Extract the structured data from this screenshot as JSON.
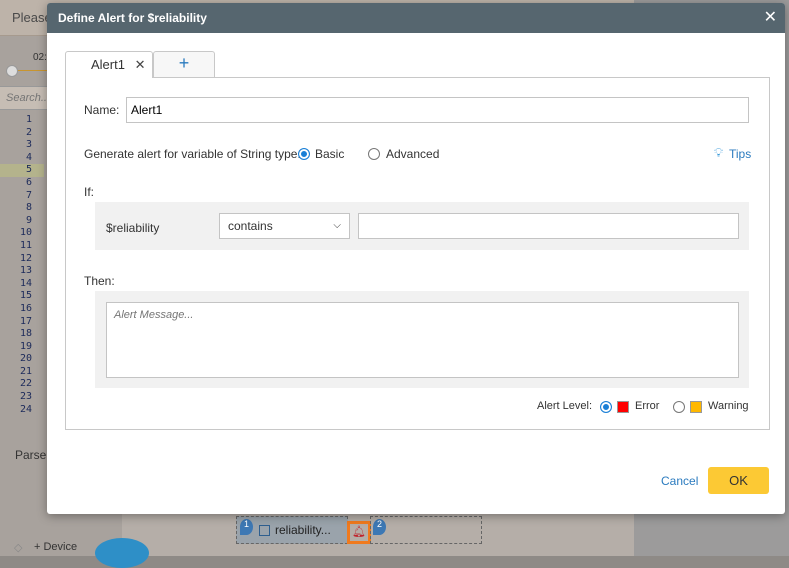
{
  "background": {
    "header_text": "Please",
    "time_label": "02:",
    "search_placeholder": "Search...",
    "line_numbers": [
      "1",
      "2",
      "3",
      "4",
      "5",
      "6",
      "7",
      "8",
      "9",
      "10",
      "11",
      "12",
      "13",
      "14",
      "15",
      "16",
      "17",
      "18",
      "19",
      "20",
      "21",
      "22",
      "23",
      "24"
    ],
    "parser_label": "Parser",
    "add_device": "+ Device",
    "node_label": "reliability...",
    "pin1": "1",
    "pin2": "2"
  },
  "dialog": {
    "title": "Define Alert for $reliability",
    "tabs": [
      {
        "label": "Alert1"
      },
      {
        "label": "+"
      }
    ],
    "name_label": "Name:",
    "name_value": "Alert1",
    "generate_label": "Generate alert for variable of String type:",
    "mode_options": [
      {
        "label": "Basic",
        "selected": true
      },
      {
        "label": "Advanced",
        "selected": false
      }
    ],
    "tips_label": "Tips",
    "if_label": "If:",
    "variable": "$reliability",
    "operator": "contains",
    "condition_value": "",
    "then_label": "Then:",
    "message_placeholder": "Alert Message...",
    "alert_level_label": "Alert Level:",
    "levels": [
      {
        "label": "Error",
        "color": "#ff0000",
        "selected": true
      },
      {
        "label": "Warning",
        "color": "#ffb800",
        "selected": false
      }
    ],
    "cancel_label": "Cancel",
    "ok_label": "OK"
  }
}
